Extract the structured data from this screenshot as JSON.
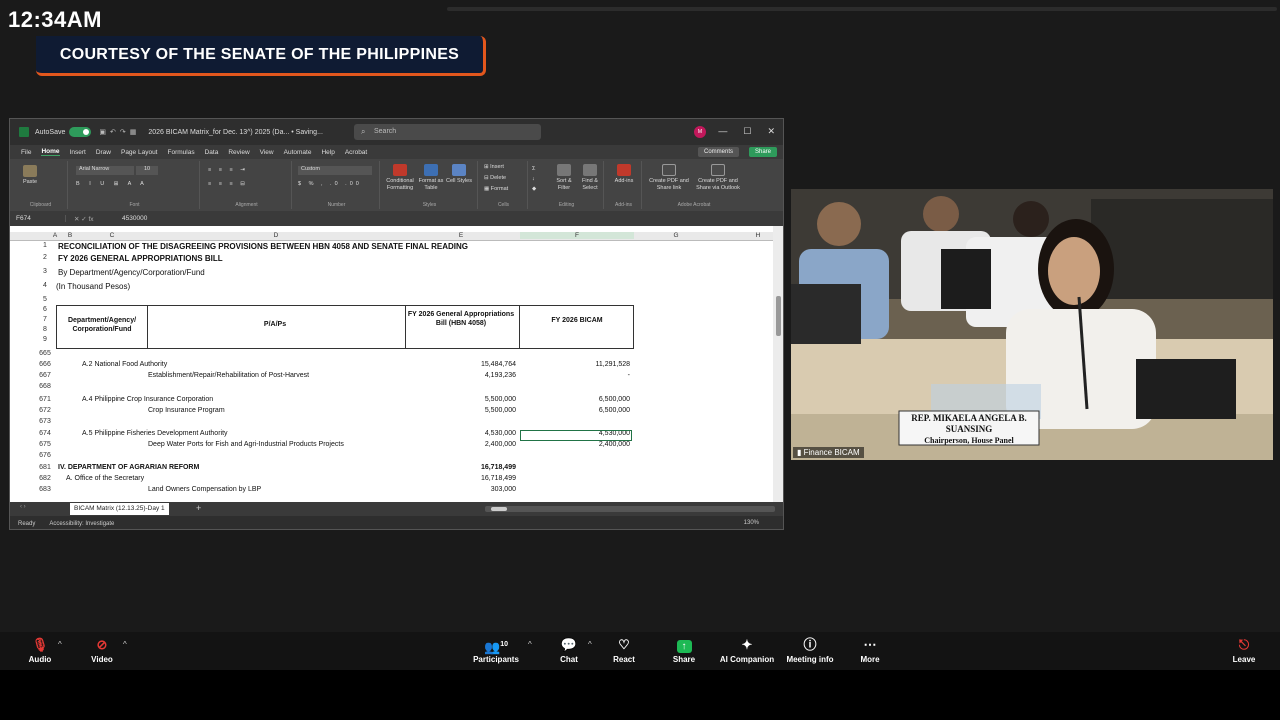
{
  "overlay": {
    "clock": "12:34AM",
    "courtesy": "COURTESY OF THE SENATE OF THE PHILIPPINES"
  },
  "excel": {
    "autosave": "AutoSave",
    "filename": "2026 BICAM Matrix_for Dec. 13^) 2025 (Da... • Saving...",
    "search_placeholder": "Search",
    "avatar": "M",
    "menu": [
      "File",
      "Home",
      "Insert",
      "Draw",
      "Page Layout",
      "Formulas",
      "Data",
      "Review",
      "View",
      "Automate",
      "Help",
      "Acrobat"
    ],
    "comments": "Comments",
    "share": "Share",
    "ribbon": {
      "paste": "Paste",
      "font_name": "Arial Narrow",
      "font_size": "10",
      "number_format": "Custom",
      "groups": [
        "Clipboard",
        "Font",
        "Alignment",
        "Number",
        "Styles",
        "Cells",
        "Editing",
        "Add-ins",
        "Adobe Acrobat"
      ],
      "styles_btns": [
        "Conditional Formatting",
        "Format as Table",
        "Cell Styles"
      ],
      "cells_btns": [
        "Insert",
        "Delete",
        "Format"
      ],
      "editing_btns": [
        "Sort & Filter",
        "Find & Select"
      ],
      "addins_btn": "Add-ins",
      "acrobat_btns": [
        "Create PDF and Share link",
        "Create PDF and Share via Outlook"
      ]
    },
    "namebox": "F674",
    "formula": "4530000",
    "columns": [
      "A",
      "B",
      "C",
      "D",
      "E",
      "F",
      "G",
      "H"
    ],
    "title_rows": {
      "r1": "RECONCILIATION OF THE DISAGREEING PROVISIONS BETWEEN HBN 4058 AND SENATE FINAL READING",
      "r2": "FY 2026 GENERAL APPROPRIATIONS BILL",
      "r3": "By Department/Agency/Corporation/Fund",
      "r4": "(In Thousand Pesos)"
    },
    "header": {
      "dept": "Department/Agency/ Corporation/Fund",
      "pap": "P/A/Ps",
      "hbn": "FY 2026 General Appropriations Bill (HBN 4058)",
      "bicam": "FY 2026 BICAM"
    },
    "top_row_numbers": [
      "1",
      "2",
      "3",
      "4",
      "5",
      "6",
      "7",
      "8",
      "9"
    ],
    "rows": [
      {
        "n": "665",
        "c": "",
        "d": "",
        "e": "",
        "f": ""
      },
      {
        "n": "666",
        "c": "A.2 National Food Authority",
        "d": "",
        "e": "15,484,764",
        "f": "11,291,528"
      },
      {
        "n": "667",
        "c": "",
        "d": "Establishment/Repair/Rehabilitation of Post-Harvest",
        "e": "4,193,236",
        "f": "-"
      },
      {
        "n": "668",
        "c": "",
        "d": "",
        "e": "",
        "f": ""
      },
      {
        "n": "671",
        "c": "A.4 Philippine Crop Insurance Corporation",
        "d": "",
        "e": "5,500,000",
        "f": "6,500,000"
      },
      {
        "n": "672",
        "c": "",
        "d": "Crop Insurance Program",
        "e": "5,500,000",
        "f": "6,500,000"
      },
      {
        "n": "673",
        "c": "",
        "d": "",
        "e": "",
        "f": ""
      },
      {
        "n": "674",
        "c": "A.5 Philippine Fisheries Development Authority",
        "d": "",
        "e": "4,530,000",
        "f": "4,530,000"
      },
      {
        "n": "675",
        "c": "",
        "d": "Deep Water Ports for Fish and Agri-Industrial Products Projects",
        "e": "2,400,000",
        "f": "2,400,000"
      },
      {
        "n": "676",
        "c": "",
        "d": "",
        "e": "",
        "f": ""
      },
      {
        "n": "681",
        "c": "IV. DEPARTMENT OF AGRARIAN REFORM",
        "d": "",
        "e": "16,718,499",
        "f": ""
      },
      {
        "n": "682",
        "c": "A. Office of the Secretary",
        "d": "",
        "e": "16,718,499",
        "f": ""
      },
      {
        "n": "683",
        "c": "",
        "d": "Land Owners Compensation by LBP",
        "e": "303,000",
        "f": ""
      }
    ],
    "sheet_tab": "BICAM Matrix (12.13.25)-Day 1",
    "status_ready": "Ready",
    "status_access": "Accessibility: Investigate",
    "zoom": "130%"
  },
  "video": {
    "label": "Finance BICAM",
    "nameplate": "REP. MIKAELA ANGELA B. SUANSING",
    "nameplate_sub": "Chairperson, House Panel"
  },
  "toolbar": {
    "audio": "Audio",
    "video": "Video",
    "participants": "Participants",
    "participants_count": "10",
    "chat": "Chat",
    "react": "React",
    "share": "Share",
    "ai": "AI Companion",
    "meeting_info": "Meeting info",
    "more": "More",
    "leave": "Leave"
  }
}
